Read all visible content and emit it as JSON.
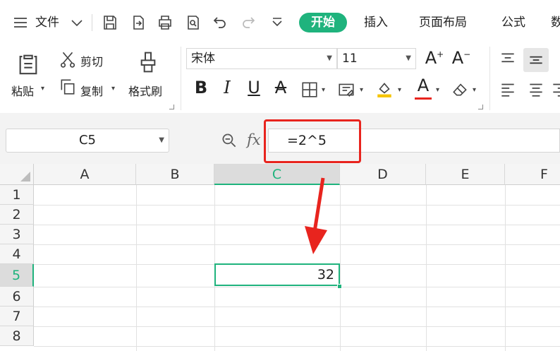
{
  "menubar": {
    "file_label": "文件",
    "tabs": [
      "开始",
      "插入",
      "页面布局",
      "公式",
      "数"
    ]
  },
  "ribbon": {
    "clipboard": {
      "paste": "粘贴",
      "cut": "剪切",
      "copy": "复制",
      "format_painter": "格式刷"
    },
    "font_name": "宋体",
    "font_size": "11",
    "bold": "B",
    "italic": "I",
    "underline": "U",
    "font_color_letter": "A",
    "increase_font": "A",
    "decrease_font": "A",
    "strike_letter": "A",
    "colors": {
      "font_color_bar": "#e8241e",
      "highlight_bar": "#f5c400",
      "accent": "#1fb37d"
    }
  },
  "formula_bar": {
    "name_box": "C5",
    "fx_label": "fx",
    "formula": "=2^5"
  },
  "sheet": {
    "columns": [
      "A",
      "B",
      "C",
      "D",
      "E",
      "F"
    ],
    "rows": [
      "1",
      "2",
      "3",
      "4",
      "5",
      "6",
      "7",
      "8"
    ],
    "active_column": "C",
    "active_row": "5",
    "selected_cell_value": "32"
  }
}
